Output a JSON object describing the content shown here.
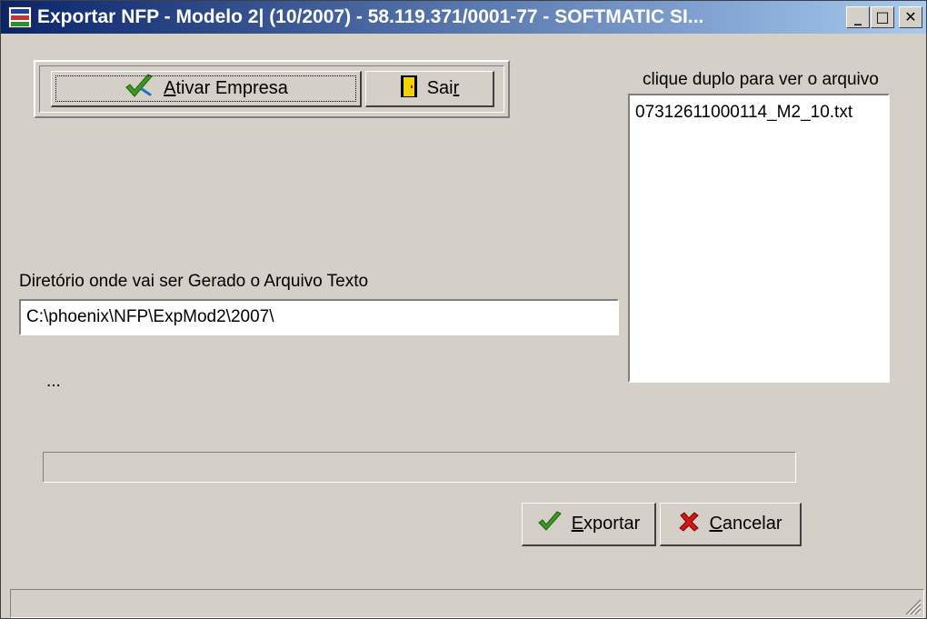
{
  "window": {
    "title": "Exportar NFP - Modelo 2| (10/2007) - 58.119.371/0001-77 - SOFTMATIC SI...",
    "minimize_glyph": "_",
    "maximize_glyph": "□",
    "close_glyph": "✕"
  },
  "toolbar": {
    "ativar_label": "Ativar Empresa",
    "ativar_mnemonic": "A",
    "ativar_rest": "tivar Empresa",
    "sair_label": "Sair",
    "sair_pre": "Sai",
    "sair_mnemonic": "r"
  },
  "file_list": {
    "hint": "clique duplo para ver o arquivo",
    "items": [
      "07312611000114_M2_10.txt"
    ]
  },
  "directory": {
    "label": "Diretório onde vai ser Gerado o Arquivo Texto",
    "value": "C:\\phoenix\\NFP\\ExpMod2\\2007\\"
  },
  "status_text": "...",
  "progress": {
    "fraction": 0
  },
  "actions": {
    "exportar_label": "Exportar",
    "exportar_mnemonic": "E",
    "exportar_rest": "xportar",
    "cancelar_label": "Cancelar",
    "cancelar_mnemonic": "C",
    "cancelar_rest": "ancelar"
  },
  "icons": {
    "app": "app-logo-icon",
    "ativar": "green-check-icon",
    "sair": "exit-door-icon",
    "exportar": "green-check-icon",
    "cancelar": "red-x-icon"
  },
  "colors": {
    "titlebar_start": "#0a246a",
    "titlebar_end": "#a6caf0",
    "window_bg": "#d4d0c8",
    "check_green": "#3a9a1f",
    "cancel_red": "#d01818",
    "door_yellow": "#f2d200"
  }
}
